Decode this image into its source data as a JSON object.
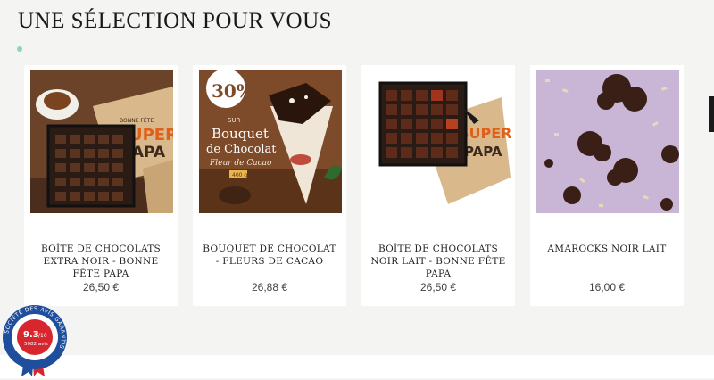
{
  "section": {
    "title": "UNE SÉLECTION POUR VOUS"
  },
  "products": [
    {
      "name": "BOÎTE DE CHOCOLATS EXTRA NOIR - BONNE FÊTE PAPA",
      "price": "26,50 €",
      "image": "gift-box-chocolates-extra-noir"
    },
    {
      "name": "BOUQUET DE CHOCOLAT - FLEURS DE CACAO",
      "price": "26,88 €",
      "image": "chocolate-bouquet-promo",
      "promo": {
        "discount": "30%",
        "sur": "SUR",
        "line1": "Bouquet",
        "line2": "de Chocolat",
        "subtitle": "Fleur de Cacao",
        "price_tag": "400 g"
      }
    },
    {
      "name": "BOÎTE DE CHOCOLATS NOIR LAIT - BONNE FÊTE PAPA",
      "price": "26,50 €",
      "image": "gift-box-chocolates-noir-lait"
    },
    {
      "name": "AMAROCKS NOIR LAIT",
      "price": "16,00 €",
      "image": "amarocks-chocolate-clusters"
    }
  ],
  "box_text": {
    "top": "BONNE FÊTE",
    "big1": "SUPER",
    "big2": "PAPA"
  },
  "review_badge": {
    "score": "9.3",
    "scale": "/10",
    "count": "5082 avis",
    "ring_text": "SOCIÉTÉ DES AVIS GARANTIS",
    "colors": {
      "ring": "#1f4e9c",
      "center": "#d8262f"
    }
  },
  "colors": {
    "accent_dot": "#8fd3c1",
    "card_bg": "#ffffff",
    "page_bg": "#f4f4f2"
  }
}
